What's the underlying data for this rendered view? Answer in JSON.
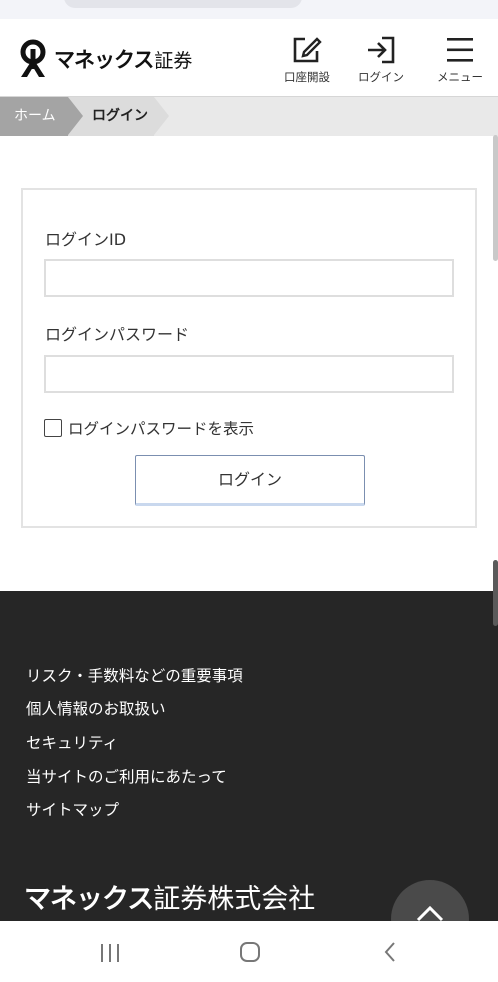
{
  "header": {
    "brand_main": "マネックス",
    "brand_sub": "証券",
    "nav": [
      {
        "label": "口座開設",
        "icon": "edit-icon"
      },
      {
        "label": "ログイン",
        "icon": "login-icon"
      },
      {
        "label": "メニュー",
        "icon": "menu-icon"
      }
    ]
  },
  "breadcrumb": {
    "home": "ホーム",
    "current": "ログイン"
  },
  "form": {
    "id_label": "ログインID",
    "id_value": "",
    "password_label": "ログインパスワード",
    "password_value": "",
    "show_password_label": "ログインパスワードを表示",
    "show_password_checked": false,
    "submit_label": "ログイン"
  },
  "footer": {
    "links": [
      "リスク・手数料などの重要事項",
      "個人情報のお取扱い",
      "セキュリティ",
      "当サイトのご利用にあたって",
      "サイトマップ"
    ],
    "company_brand": "マネックス",
    "company_rest": "証券株式会社"
  },
  "colors": {
    "footer_bg": "#262626",
    "breadcrumb_home_bg": "#a4a4a4",
    "button_border": "#7b8fb0"
  }
}
